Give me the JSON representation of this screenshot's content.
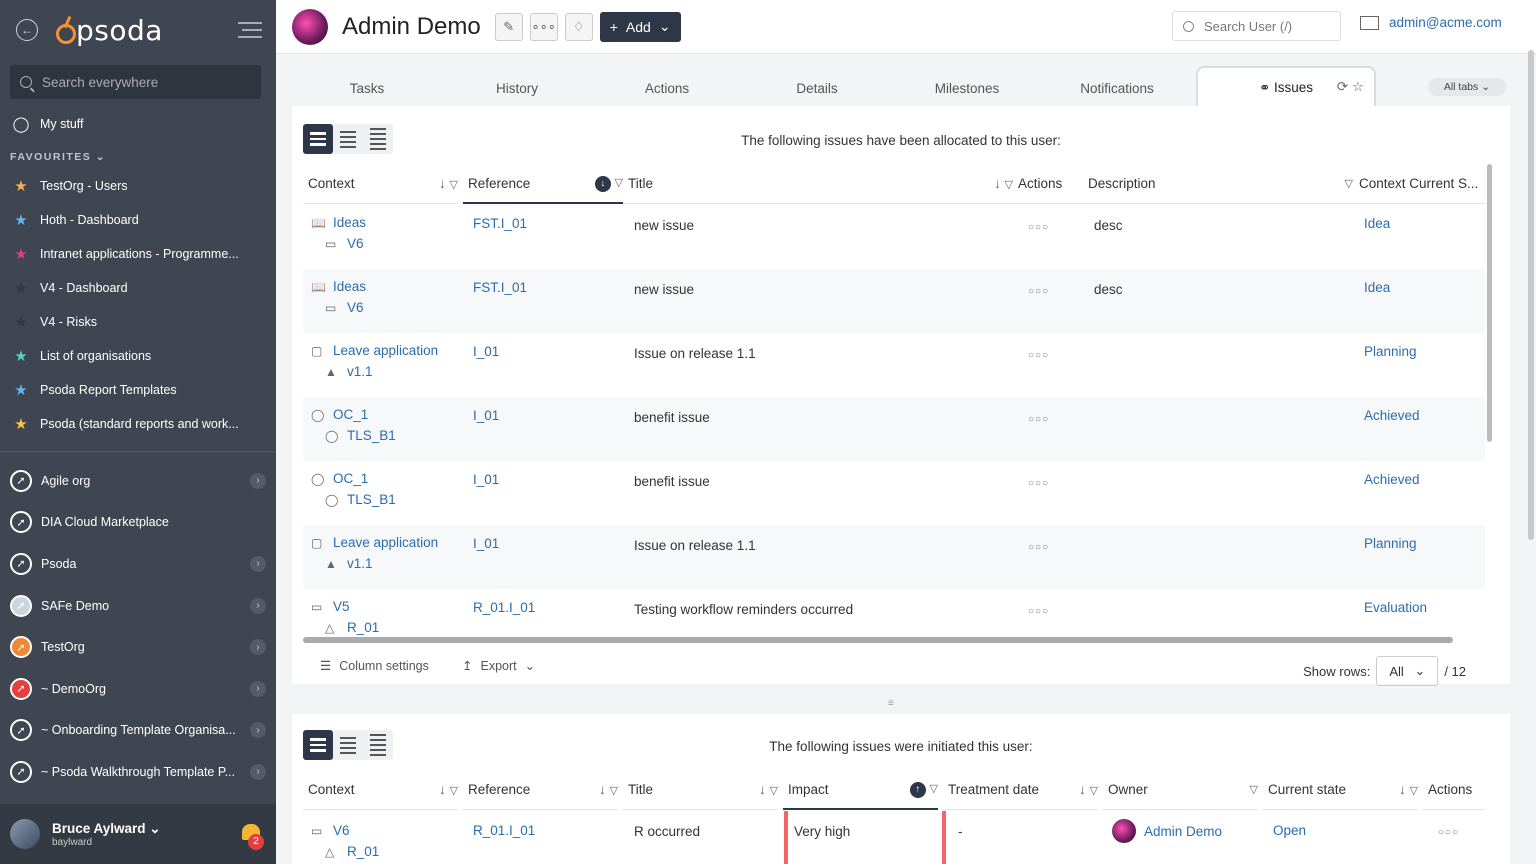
{
  "sidebar": {
    "search_placeholder": "Search everywhere",
    "my_stuff": "My stuff",
    "favourites_header": "FAVOURITES",
    "favourites": [
      {
        "label": "TestOrg - Users",
        "color": "#f6ad55"
      },
      {
        "label": "Hoth - Dashboard",
        "color": "#63b3ed"
      },
      {
        "label": "Intranet applications - Programme...",
        "color": "#d53f8c"
      },
      {
        "label": "V4 - Dashboard",
        "color": "#2d3748"
      },
      {
        "label": "V4 - Risks",
        "color": "#2d3748"
      },
      {
        "label": "List of organisations",
        "color": "#4fd1c5"
      },
      {
        "label": "Psoda Report Templates",
        "color": "#63b3ed"
      },
      {
        "label": "Psoda (standard reports and work...",
        "color": "#f6c343"
      }
    ],
    "orgs": [
      {
        "label": "Agile org"
      },
      {
        "label": "DIA Cloud Marketplace"
      },
      {
        "label": "Psoda"
      },
      {
        "label": "SAFe Demo"
      },
      {
        "label": "TestOrg"
      },
      {
        "label": "~ DemoOrg"
      },
      {
        "label": "~ Onboarding Template Organisa..."
      },
      {
        "label": "~ Psoda Walkthrough Template P..."
      }
    ],
    "user": {
      "name": "Bruce Aylward",
      "handle": "baylward",
      "notifications": "2"
    }
  },
  "header": {
    "logo": "psoda",
    "title": "Admin Demo",
    "add_label": "Add",
    "search_placeholder": "Search User (/)",
    "email": "admin@acme.com"
  },
  "tabs": {
    "items": [
      "Tasks",
      "History",
      "Actions",
      "Details",
      "Milestones",
      "Notifications"
    ],
    "active": "Issues",
    "all_tabs": "All tabs"
  },
  "allocated": {
    "caption": "The following issues have been allocated to this user:",
    "headers": {
      "context": "Context",
      "reference": "Reference",
      "title": "Title",
      "actions": "Actions",
      "description": "Description",
      "state": "Context Current S..."
    },
    "rows": [
      {
        "ctx": "Ideas",
        "sub": "V6",
        "ref": "FST.I_01",
        "title": "new issue",
        "desc": "desc",
        "state": "Idea"
      },
      {
        "ctx": "Ideas",
        "sub": "V6",
        "ref": "FST.I_01",
        "title": "new issue",
        "desc": "desc",
        "state": "Idea"
      },
      {
        "ctx": "Leave application",
        "sub": "v1.1",
        "ref": "I_01",
        "title": "Issue on release 1.1",
        "desc": "",
        "state": "Planning"
      },
      {
        "ctx": "OC_1",
        "sub": "TLS_B1",
        "ref": "I_01",
        "title": "benefit issue",
        "desc": "",
        "state": "Achieved"
      },
      {
        "ctx": "OC_1",
        "sub": "TLS_B1",
        "ref": "I_01",
        "title": "benefit issue",
        "desc": "",
        "state": "Achieved"
      },
      {
        "ctx": "Leave application",
        "sub": "v1.1",
        "ref": "I_01",
        "title": "Issue on release 1.1",
        "desc": "",
        "state": "Planning"
      },
      {
        "ctx": "V5",
        "sub": "R_01",
        "ref": "R_01.I_01",
        "title": "Testing workflow reminders occurred",
        "desc": "",
        "state": "Evaluation"
      }
    ],
    "column_settings": "Column settings",
    "export": "Export",
    "show_rows_label": "Show rows:",
    "show_rows_value": "All",
    "total": "/ 12"
  },
  "initiated": {
    "caption": "The following issues were initiated this user:",
    "headers": {
      "context": "Context",
      "reference": "Reference",
      "title": "Title",
      "impact": "Impact",
      "treatment": "Treatment date",
      "owner": "Owner",
      "state": "Current state",
      "actions": "Actions"
    },
    "rows": [
      {
        "ctx": "V6",
        "sub": "R_01",
        "ref": "R_01.I_01",
        "title": "R occurred",
        "impact": "Very high",
        "treatment": "-",
        "owner": "Admin Demo",
        "state": "Open"
      }
    ]
  }
}
